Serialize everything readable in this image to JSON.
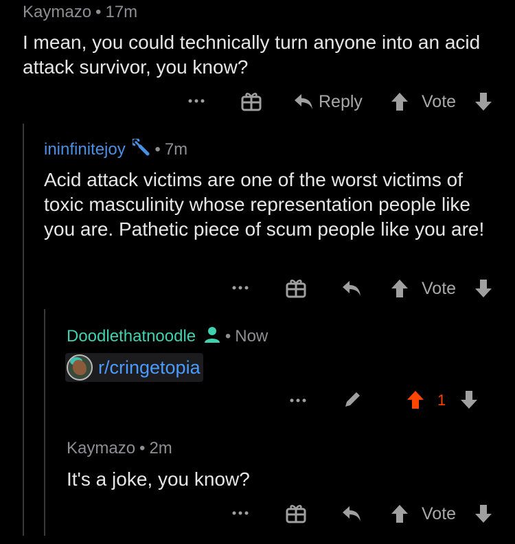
{
  "comments": [
    {
      "author": "Kaymazo",
      "time": "17m",
      "text": "I mean, you could technically turn anyone into an acid attack survivor, you know?",
      "actions": {
        "reply_label": "Reply",
        "vote_label": "Vote"
      }
    },
    {
      "author": "ininfinitejoy",
      "time": "7m",
      "text": "Acid attack victims are one of the worst victims of toxic masculinity whose representation people like you are. Pathetic piece of scum people like you are!",
      "actions": {
        "vote_label": "Vote"
      }
    },
    {
      "author": "Doodlethatnoodle",
      "time": "Now",
      "link_text": "r/cringetopia",
      "actions": {
        "vote_count": "1"
      }
    },
    {
      "author": "Kaymazo",
      "time": "2m",
      "text": "It's a joke, you know?",
      "actions": {
        "vote_label": "Vote"
      }
    }
  ],
  "separator": "•",
  "colors": {
    "upvote_active": "#ff4500",
    "link": "#4a9bff",
    "mod_blue": "#4a90e2",
    "op_teal": "#3fd1b0"
  },
  "icons": [
    "more-icon",
    "gift-icon",
    "reply-icon",
    "upvote-icon",
    "downvote-icon",
    "pencil-icon",
    "wrench-icon",
    "person-icon"
  ]
}
